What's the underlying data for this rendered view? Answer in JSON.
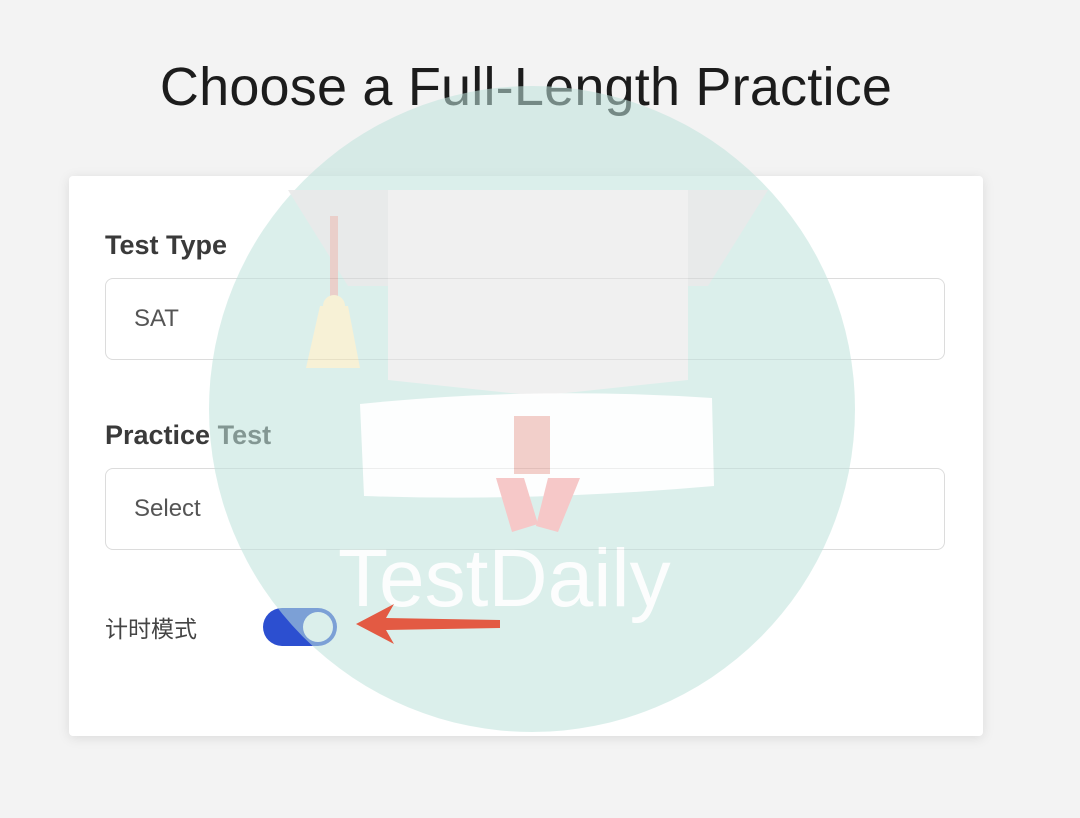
{
  "page": {
    "title": "Choose a Full-Length Practice"
  },
  "form": {
    "test_type": {
      "label": "Test Type",
      "value": "SAT"
    },
    "practice_test": {
      "label": "Practice Test",
      "placeholder": "Select"
    },
    "timer_mode": {
      "label": "计时模式",
      "enabled": true
    }
  },
  "watermark": {
    "text": "TestDaily",
    "icon": "graduation-cap-icon"
  },
  "annotation": {
    "icon": "arrow-left-icon",
    "color": "#e35a43"
  },
  "colors": {
    "toggle_on": "#2c4fd0",
    "watermark_circle": "#bfe3dc"
  }
}
